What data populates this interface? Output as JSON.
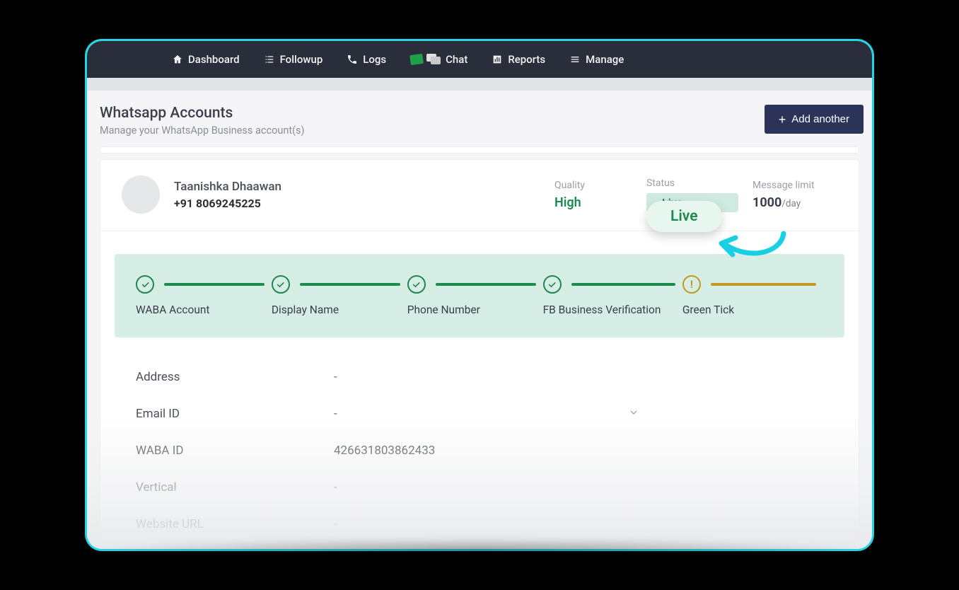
{
  "nav": {
    "dashboard": "Dashboard",
    "followup": "Followup",
    "logs": "Logs",
    "chat": "Chat",
    "reports": "Reports",
    "manage": "Manage"
  },
  "page": {
    "title": "Whatsapp Accounts",
    "subtitle": "Manage your WhatsApp Business account(s)",
    "add_button": "Add another"
  },
  "account": {
    "name": "Taanishka Dhaawan",
    "phone": "+91 8069245225",
    "quality_label": "Quality",
    "quality_value": "High",
    "status_label": "Status",
    "status_value": "Live",
    "status_callout": "Live",
    "msg_limit_label": "Message limit",
    "msg_limit_value": "1000",
    "msg_limit_unit": "/day"
  },
  "steps": {
    "s1": "WABA Account",
    "s2": "Display Name",
    "s3": "Phone Number",
    "s4": "FB Business Verification",
    "s5": "Green Tick"
  },
  "details": {
    "address_label": "Address",
    "address_value": "-",
    "email_label": "Email ID",
    "email_value": "-",
    "waba_label": "WABA ID",
    "waba_value": "426631803862433",
    "vertical_label": "Vertical",
    "vertical_value": "-",
    "website_label": "Website URL",
    "website_value": "-"
  }
}
